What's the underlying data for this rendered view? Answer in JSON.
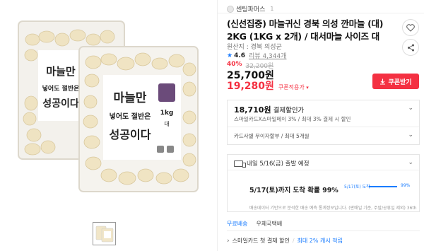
{
  "breadcrumb": {
    "shop": "센팅파머스",
    "count": "1"
  },
  "product": {
    "title": "(신선집중) 마늘귀신 경북 의성 깐마늘 (대) 2KG (1KG x 2개) / 대서마늘 사이즈 대",
    "origin": "원산지 : 경북 의성군",
    "rating": "4.6",
    "reviews": "리뷰 4,344개",
    "package_text": {
      "brand_line1": "마늘만",
      "brand_line2": "넣어도 절반은",
      "brand_line3": "성공이다",
      "weight": "1kg",
      "size": "대"
    }
  },
  "price": {
    "discount_rate": "40%",
    "original": "32,200원",
    "sale": "25,700원",
    "coupon_price": "19,280원",
    "coupon_applied": "쿠폰적용가",
    "coupon_button": "쿠폰받기"
  },
  "benefit": {
    "title_amount": "18,710원",
    "title_suffix": " 결제할인가",
    "sub": "스마일카드X스마일페이 3% / 최대 3% 결제 시 할인",
    "installment": "카드사별 무이자할부 / 최대 5개월"
  },
  "delivery": {
    "header": "내일 5/16(금) 출발 예정",
    "probability_text": "5/17(토)까지 도착 확률 99%",
    "chart_label": "5/17(토) 도착",
    "chart_value_label": "99%",
    "probability": 0.99,
    "note": "배송데이터 기반으로 분석한 배송 예측 통계정보입니다. (판매일 기준, 주말/공휴일 제외) 36th"
  },
  "shipping": {
    "free": "무료배송",
    "method": "우체국택배"
  },
  "promo": {
    "text": "스마일카드 첫 결제 할인",
    "highlight": "최대 2% 캐시 적립"
  },
  "icons": {
    "wishlist": "heart-icon",
    "share": "share-icon",
    "download": "download-icon",
    "chevron": "chevron-down-icon"
  },
  "colors": {
    "accent_red": "#f43142",
    "accent_blue": "#1a7cff"
  }
}
